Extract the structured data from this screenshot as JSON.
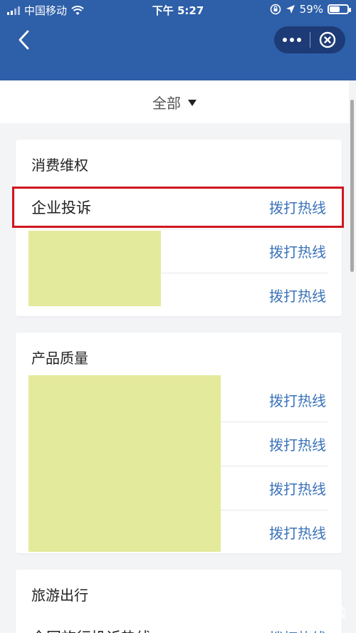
{
  "status": {
    "carrier": "中国移动",
    "time": "下午 5:27",
    "battery": "59%",
    "battery_level": 0.59
  },
  "filter": {
    "label": "全部"
  },
  "sections": [
    {
      "title": "消费维权",
      "rows": [
        {
          "name": "企业投诉",
          "action": "拨打热线"
        },
        {
          "name": "",
          "action": "拨打热线"
        },
        {
          "name": "",
          "action": "拨打热线"
        }
      ]
    },
    {
      "title": "产品质量",
      "rows": [
        {
          "name": "",
          "action": "拨打热线"
        },
        {
          "name": "",
          "action": "拨打热线"
        },
        {
          "name": "",
          "action": "拨打热线"
        },
        {
          "name": "",
          "action": "拨打热线"
        }
      ]
    },
    {
      "title": "旅游出行",
      "rows": [
        {
          "name": "全国旅行投诉热线",
          "action": "拨打热线"
        }
      ]
    }
  ],
  "watermark": "Bai du 经验"
}
